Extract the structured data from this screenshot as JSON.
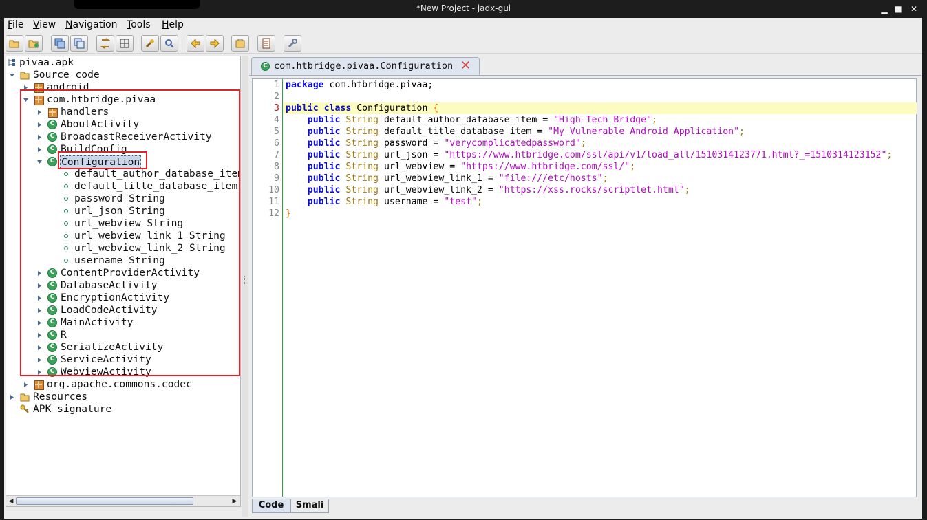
{
  "window": {
    "title": "*New Project - jadx-gui"
  },
  "menu": [
    {
      "label": "File",
      "mnemonic": "F",
      "rest": "ile"
    },
    {
      "label": "View",
      "mnemonic": "V",
      "rest": "iew"
    },
    {
      "label": "Navigation",
      "mnemonic": "N",
      "rest": "avigation"
    },
    {
      "label": "Tools",
      "mnemonic": "T",
      "rest": "ools"
    },
    {
      "label": "Help",
      "mnemonic": "H",
      "rest": "elp"
    }
  ],
  "toolbar": [
    "open-file-icon",
    "add-files-icon",
    "save-all-icon",
    "export-icon",
    "sync-icon",
    "flatten-packages-icon",
    "search-text-icon",
    "find-class-icon",
    "back-icon",
    "forward-icon",
    "decompile-icon",
    "log-viewer-icon",
    "preferences-icon"
  ],
  "tree": {
    "root": "pivaa.apk",
    "source_code": "Source code",
    "android": "android",
    "pkg": "com.htbridge.pivaa",
    "items": {
      "handlers": "handlers",
      "about": "AboutActivity",
      "broadcast": "BroadcastReceiverActivity",
      "buildconfig": "BuildConfig",
      "configuration": "Configuration",
      "content_provider": "ContentProviderActivity",
      "database": "DatabaseActivity",
      "encryption": "EncryptionActivity",
      "loadcode": "LoadCodeActivity",
      "main": "MainActivity",
      "r": "R",
      "serialize": "SerializeActivity",
      "service": "ServiceActivity",
      "webview": "WebviewActivity"
    },
    "fields": [
      "default_author_database_item String",
      "default_title_database_item String",
      "password String",
      "url_json String",
      "url_webview String",
      "url_webview_link_1 String",
      "url_webview_link_2 String",
      "username String"
    ],
    "codec": "org.apache.commons.codec",
    "resources": "Resources",
    "apk_signature": "APK signature"
  },
  "editor": {
    "tab_title": "com.htbridge.pivaa.Configuration",
    "current_line": 3,
    "line_numbers": [
      "1",
      "2",
      "3",
      "4",
      "5",
      "6",
      "7",
      "8",
      "9",
      "10",
      "11",
      "12"
    ],
    "package_kw": "package",
    "package_name": " com.htbridge.pivaa;",
    "class_kw": "public class",
    "class_name": " Configuration ",
    "open_brace": "{",
    "close_brace": "}",
    "public_kw": "public",
    "string_type": "String",
    "fields": [
      {
        "name": "default_author_database_item",
        "value": "\"High-Tech Bridge\""
      },
      {
        "name": "default_title_database_item",
        "value": "\"My Vulnerable Android Application\""
      },
      {
        "name": "password",
        "value": "\"verycomplicatedpassword\""
      },
      {
        "name": "url_json",
        "value": "\"https://www.htbridge.com/ssl/api/v1/load_all/1510314123771.html?_=1510314123152\""
      },
      {
        "name": "url_webview",
        "value": "\"https://www.htbridge.com/ssl/\""
      },
      {
        "name": "url_webview_link_1",
        "value": "\"file:///etc/hosts\""
      },
      {
        "name": "url_webview_link_2",
        "value": "\"https://xss.rocks/scriptlet.html\""
      },
      {
        "name": "username",
        "value": "\"test\""
      }
    ]
  },
  "bottom_tabs": [
    "Code",
    "Smali"
  ],
  "colors": {
    "highlight_box": "#e0222b",
    "keyword": "#0b0bd0",
    "string": "#b00fbf",
    "type": "#9a7b10",
    "current_line_bg": "#fcfcbf"
  }
}
